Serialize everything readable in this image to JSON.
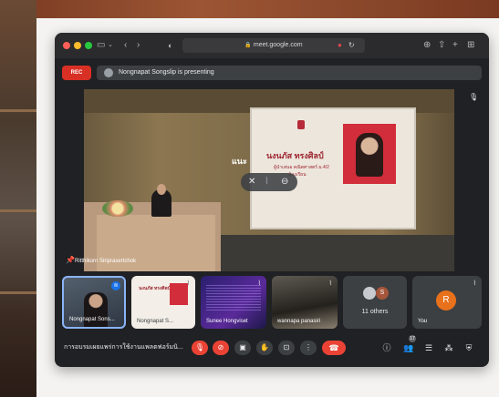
{
  "browser": {
    "url": "meet.google.com"
  },
  "presenting_bar": {
    "rec_label": "REC",
    "message": "Nongnapat Songslip is presenting"
  },
  "stage": {
    "speaker_name": "Ritthikorn Siriprasertchok",
    "slide_name": "นงนภัส ทรงศิลป์",
    "slide_sub1": "ผู้นำเสนอ คณิตศาสตร์ ม.4/2",
    "slide_sub2": "ห้องเรียน",
    "side_text": "แนะ"
  },
  "participants": [
    {
      "name": "Nongnapat Sons...",
      "speaking": true
    },
    {
      "name": "Nongnapat S..."
    },
    {
      "name": "Sunee Hongviset"
    },
    {
      "name": "wannapa panasiri"
    },
    {
      "name": "11 others",
      "avatar_letter": "S"
    },
    {
      "name": "You",
      "avatar_letter": "R"
    }
  ],
  "meeting": {
    "title": "การอบรมเผยแพร่การใช้งานแพลตฟอร์มนิ...",
    "participant_count": "17"
  },
  "colors": {
    "window_bg": "#202124",
    "accent_blue": "#8ab4f8",
    "danger_red": "#ea4335",
    "you_avatar": "#e8711c"
  }
}
